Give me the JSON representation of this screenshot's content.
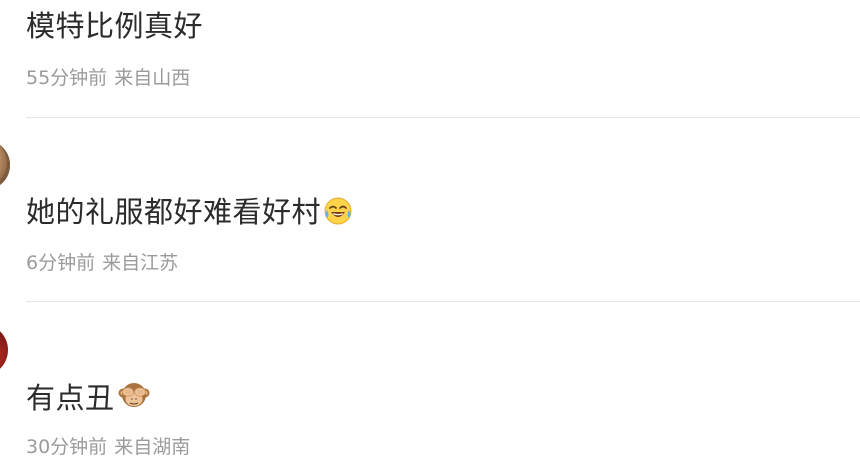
{
  "comments": [
    {
      "text": "模特比例真好",
      "time": "55分钟前",
      "location": "来自山西"
    },
    {
      "text": "她的礼服都好难看好村",
      "emoji": "laughing-crying-emoji",
      "time": "6分钟前",
      "location": "来自江苏"
    },
    {
      "text": "有点丑",
      "emoji": "see-no-evil-monkey-emoji",
      "time": "30分钟前",
      "location": "来自湖南"
    }
  ],
  "colors": {
    "text": "#2b2b2b",
    "meta": "#9b9b9b",
    "divider": "#e6e6e6",
    "background": "#ffffff"
  }
}
